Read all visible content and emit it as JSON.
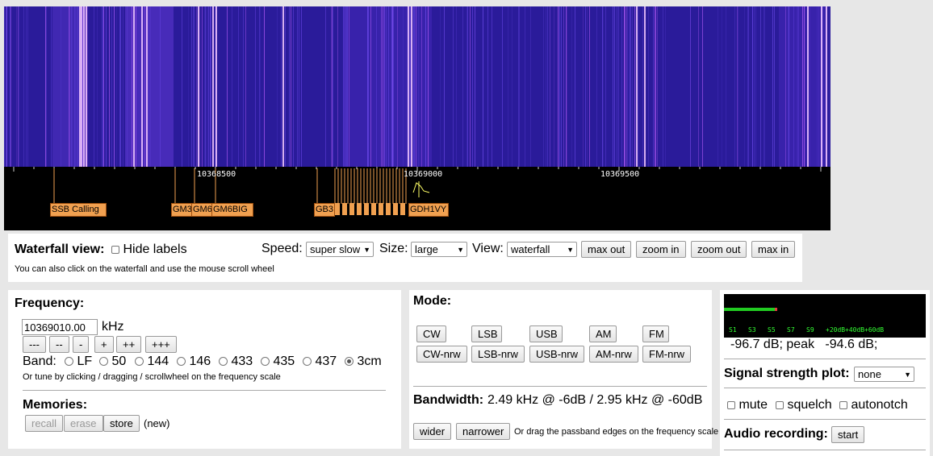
{
  "scale": {
    "tick_labels": [
      "10368500",
      "10369000",
      "10369500"
    ]
  },
  "markers": [
    "SSB Calling",
    "GM3",
    "GM6",
    "GM6BIG",
    "GB3",
    "GDH1VY"
  ],
  "waterfall_controls": {
    "title": "Waterfall view:",
    "hide_labels": "Hide labels",
    "speed_label": "Speed:",
    "speed_value": "super slow",
    "size_label": "Size:",
    "size_value": "large",
    "view_label": "View:",
    "view_value": "waterfall",
    "max_out": "max out",
    "zoom_in": "zoom in",
    "zoom_out": "zoom out",
    "max_in": "max in",
    "hint": "You can also click on the waterfall and use the mouse scroll wheel"
  },
  "frequency": {
    "title": "Frequency:",
    "value": "10369010.00",
    "unit": "kHz",
    "steps": [
      "---",
      "--",
      "-",
      "+",
      "++",
      "+++"
    ],
    "band_label": "Band:",
    "bands": [
      "LF",
      "50",
      "144",
      "146",
      "433",
      "435",
      "437",
      "3cm"
    ],
    "selected_band": "3cm",
    "hint": "Or tune by clicking / dragging / scrollwheel on the frequency scale",
    "memories_title": "Memories:",
    "recall": "recall",
    "erase": "erase",
    "store": "store",
    "new_note": "(new)"
  },
  "mode": {
    "title": "Mode:",
    "row1": [
      "CW",
      "LSB",
      "USB",
      "AM",
      "FM"
    ],
    "row2": [
      "CW-nrw",
      "LSB-nrw",
      "USB-nrw",
      "AM-nrw",
      "FM-nrw"
    ],
    "bandwidth_label": "Bandwidth:",
    "bandwidth_value": "2.49 kHz @ -6dB / 2.95 kHz @ -60dB",
    "wider": "wider",
    "narrower": "narrower",
    "drag_hint": "Or drag the passband edges on the frequency scale"
  },
  "signal": {
    "meter_labels": [
      "S1",
      "S3",
      "S5",
      "S7",
      "S9",
      "+20dB",
      "+40dB",
      "+60dB"
    ],
    "meter_level": 0.25,
    "readout": "-96.7 dB; peak   -94.6 dB;",
    "plot_label": "Signal strength plot:",
    "plot_value": "none",
    "mute": "mute",
    "squelch": "squelch",
    "autonotch": "autonotch",
    "recording_label": "Audio recording:",
    "start": "start"
  },
  "colors": {
    "waterfall_bg": "#2a1b9a",
    "marker_bg": "#f0a050",
    "meter_green": "#22cc22",
    "meter_text": "#33ff33"
  }
}
